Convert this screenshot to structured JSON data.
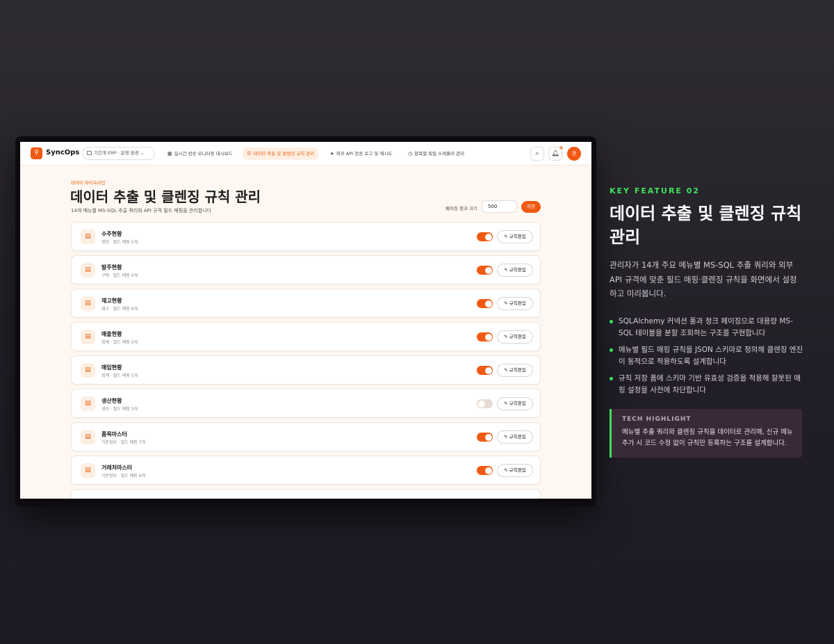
{
  "app": {
    "brand": "SyncOps",
    "environment": "기간계 ERP · 운영 환경",
    "nav": [
      {
        "label": "실시간 전송 모니터링 대시보드",
        "icon": "grid-icon",
        "active": false
      },
      {
        "label": "데이터 추출 및 클렌징 규칙 관리",
        "icon": "database-icon",
        "active": true
      },
      {
        "label": "외부 API 전송 로그 및 재시도",
        "icon": "send-icon",
        "active": false
      },
      {
        "label": "항목별 독립 스케줄러 관리",
        "icon": "timer-icon",
        "active": false
      }
    ],
    "avatar": "관"
  },
  "page": {
    "breadcrumb": "데이터 파이프라인",
    "title": "데이터 추출 및 클렌징 규칙 관리",
    "subtitle": "14개 메뉴별 MS-SQL 추출 쿼리와 API 규격 필드 매핑을 관리합니다",
    "chunk_label": "페이징 청크 크기",
    "chunk_value": "500",
    "save_label": "저장",
    "edit_label": "규칙편집"
  },
  "rules": [
    {
      "name": "수주현황",
      "meta": "영업 · 필드 매핑 5개",
      "enabled": true
    },
    {
      "name": "발주현황",
      "meta": "구매 · 필드 매핑 4개",
      "enabled": true
    },
    {
      "name": "재고현황",
      "meta": "재고 · 필드 매핑 6개",
      "enabled": true
    },
    {
      "name": "매출현황",
      "meta": "회계 · 필드 매핑 5개",
      "enabled": true
    },
    {
      "name": "매입현황",
      "meta": "회계 · 필드 매핑 5개",
      "enabled": true
    },
    {
      "name": "생산현황",
      "meta": "생산 · 필드 매핑 3개",
      "enabled": false
    },
    {
      "name": "품목마스터",
      "meta": "기준정보 · 필드 매핑 7개",
      "enabled": true
    },
    {
      "name": "거래처마스터",
      "meta": "기준정보 · 필드 매핑 6개",
      "enabled": true
    }
  ],
  "feature": {
    "kicker": "KEY FEATURE 02",
    "title": "데이터 추출 및 클렌징 규칙 관리",
    "description": "관리자가 14개 주요 메뉴별 MS-SQL 추출 쿼리와 외부 API 규격에 맞춘 필드 매핑·클렌징 규칙을 화면에서 설정하고 미리봅니다.",
    "bullets": [
      "SQLAlchemy 커넥션 풀과 청크 페이징으로 대용량 MS-SQL 테이블을 분할 조회하는 구조를 구현합니다",
      "메뉴별 필드 매핑 규칙을 JSON 스키마로 정의해 클렌징 엔진이 동적으로 적용하도록 설계합니다",
      "규칙 저장 폼에 스키마 기반 유효성 검증을 적용해 잘못된 매핑 설정을 사전에 차단합니다"
    ],
    "tech_heading": "TECH HIGHLIGHT",
    "tech_body": "메뉴별 추출 쿼리와 클렌징 규칙을 데이터로 관리해, 신규 메뉴 추가 시 코드 수정 없이 규칙만 등록하는 구조를 설계합니다."
  },
  "colors": {
    "accent": "#f15a13",
    "highlight": "#3ee25b"
  }
}
